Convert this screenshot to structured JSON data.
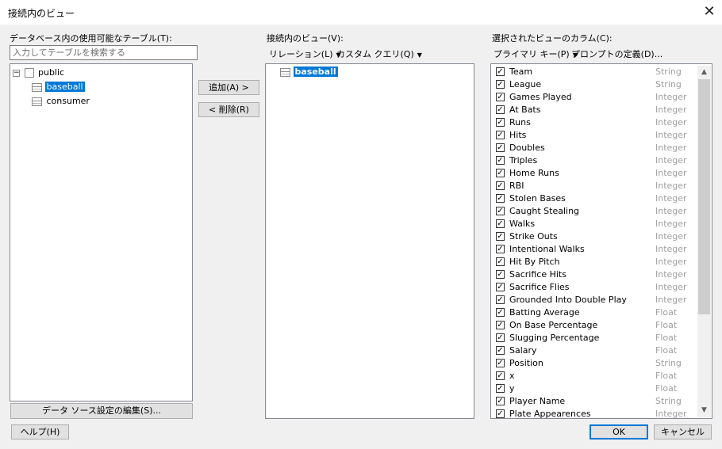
{
  "window": {
    "title": "接続内のビュー",
    "close_icon": "close-icon"
  },
  "left": {
    "label": "データベース内の使用可能なテーブル(T):",
    "search_placeholder": "入力してテーブルを検索する",
    "tree": {
      "root": "public",
      "children": [
        "baseball",
        "consumer"
      ],
      "selected": "baseball"
    },
    "edit_button": "データ ソース設定の編集(S)..."
  },
  "middle": {
    "add_button": "追加(A) >",
    "remove_button": "< 削除(R)",
    "label": "接続内のビュー(V):",
    "relation_menu": "リレーション(L)",
    "custom_query_menu": "カスタム クエリ(Q)",
    "views": [
      "baseball"
    ]
  },
  "right": {
    "label": "選択されたビューのカラム(C):",
    "primary_key_menu": "プライマリ キー(P)",
    "prompt_definition": "プロンプトの定義(D)...",
    "columns": [
      {
        "name": "Team",
        "type": "String",
        "checked": true
      },
      {
        "name": "League",
        "type": "String",
        "checked": true
      },
      {
        "name": "Games Played",
        "type": "Integer",
        "checked": true
      },
      {
        "name": "At Bats",
        "type": "Integer",
        "checked": true
      },
      {
        "name": "Runs",
        "type": "Integer",
        "checked": true
      },
      {
        "name": "Hits",
        "type": "Integer",
        "checked": true
      },
      {
        "name": "Doubles",
        "type": "Integer",
        "checked": true
      },
      {
        "name": "Triples",
        "type": "Integer",
        "checked": true
      },
      {
        "name": "Home Runs",
        "type": "Integer",
        "checked": true
      },
      {
        "name": "RBI",
        "type": "Integer",
        "checked": true
      },
      {
        "name": "Stolen Bases",
        "type": "Integer",
        "checked": true
      },
      {
        "name": "Caught Stealing",
        "type": "Integer",
        "checked": true
      },
      {
        "name": "Walks",
        "type": "Integer",
        "checked": true
      },
      {
        "name": "Strike Outs",
        "type": "Integer",
        "checked": true
      },
      {
        "name": "Intentional Walks",
        "type": "Integer",
        "checked": true
      },
      {
        "name": "Hit By Pitch",
        "type": "Integer",
        "checked": true
      },
      {
        "name": "Sacrifice Hits",
        "type": "Integer",
        "checked": true
      },
      {
        "name": "Sacrifice Flies",
        "type": "Integer",
        "checked": true
      },
      {
        "name": "Grounded Into Double Play",
        "type": "Integer",
        "checked": true
      },
      {
        "name": "Batting Average",
        "type": "Float",
        "checked": true
      },
      {
        "name": "On Base Percentage",
        "type": "Float",
        "checked": true
      },
      {
        "name": "Slugging Percentage",
        "type": "Float",
        "checked": true
      },
      {
        "name": "Salary",
        "type": "Float",
        "checked": true
      },
      {
        "name": "Position",
        "type": "String",
        "checked": true
      },
      {
        "name": "x",
        "type": "Float",
        "checked": true
      },
      {
        "name": "y",
        "type": "Float",
        "checked": true
      },
      {
        "name": "Player Name",
        "type": "String",
        "checked": true
      },
      {
        "name": "Plate Appearences",
        "type": "Integer",
        "checked": true
      }
    ]
  },
  "footer": {
    "help_button": "ヘルプ(H)",
    "ok_button": "OK",
    "cancel_button": "キャンセル"
  },
  "colors": {
    "selection": "#0078d7",
    "type_text": "#a0a0a0"
  }
}
